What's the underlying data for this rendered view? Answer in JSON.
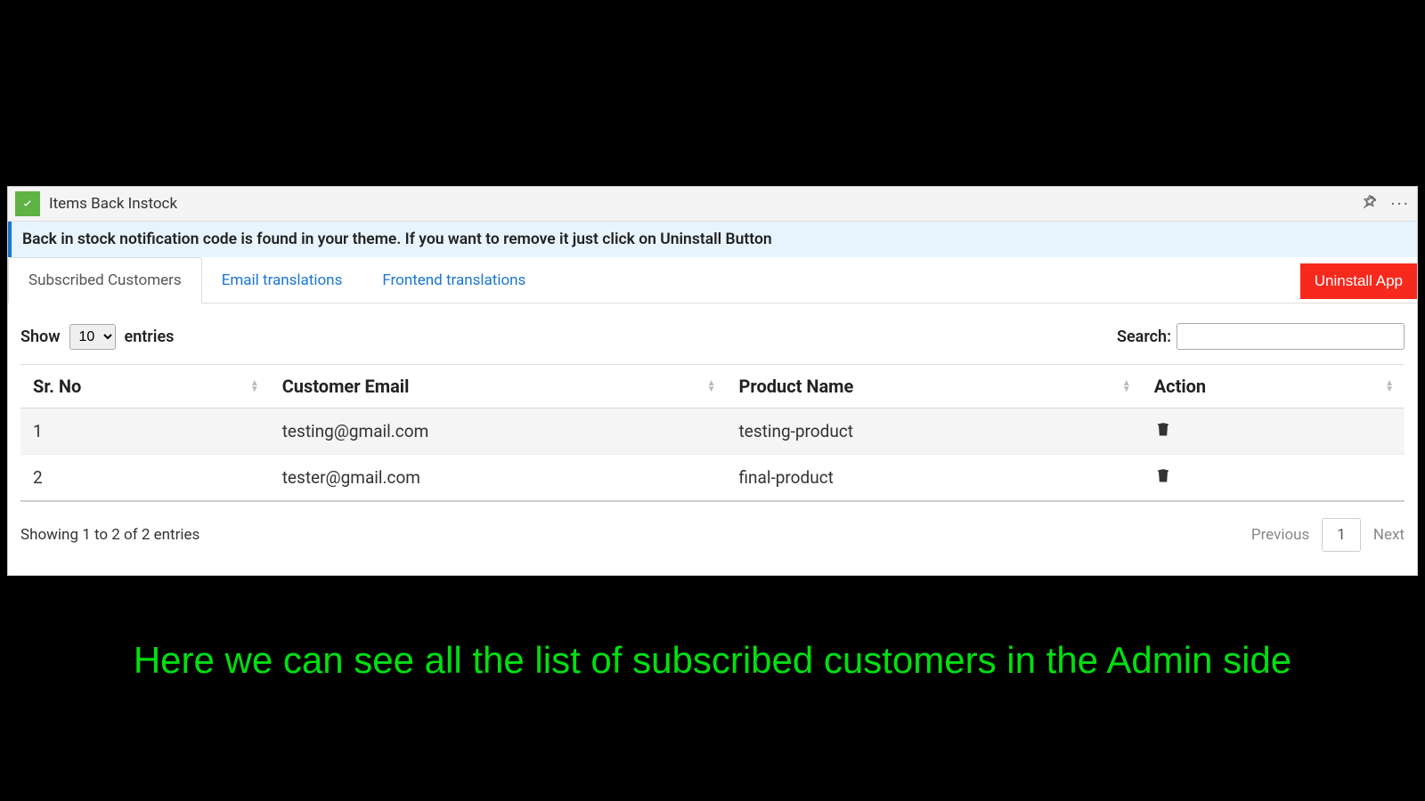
{
  "header": {
    "title": "Items Back Instock"
  },
  "notice": {
    "text": "Back in stock notification code is found in your theme. If you want to remove it just click on Uninstall Button"
  },
  "tabs": [
    {
      "label": "Subscribed Customers",
      "active": true
    },
    {
      "label": "Email translations",
      "active": false
    },
    {
      "label": "Frontend translations",
      "active": false
    }
  ],
  "buttons": {
    "uninstall": "Uninstall App"
  },
  "datatable": {
    "show_label_prefix": "Show",
    "show_label_suffix": "entries",
    "show_value": "10",
    "search_label": "Search:",
    "search_value": "",
    "columns": [
      "Sr. No",
      "Customer Email",
      "Product Name",
      "Action"
    ],
    "rows": [
      {
        "sr": "1",
        "email": "testing@gmail.com",
        "product": "testing-product"
      },
      {
        "sr": "2",
        "email": "tester@gmail.com",
        "product": "final-product"
      }
    ],
    "info": "Showing 1 to 2 of 2 entries",
    "pagination": {
      "previous": "Previous",
      "current": "1",
      "next": "Next"
    }
  },
  "caption": "Here we can see all the list of subscribed customers in the Admin side"
}
